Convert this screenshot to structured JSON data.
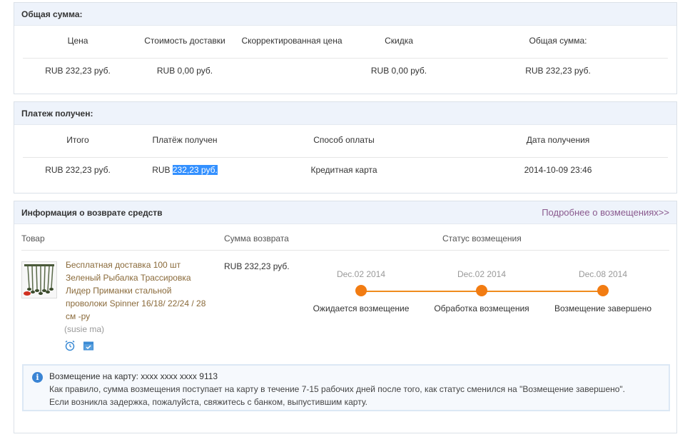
{
  "summary": {
    "title": "Общая сумма:",
    "headers": [
      "Цена",
      "Стоимость доставки",
      "Скорректированная цена",
      "Скидка",
      "Общая сумма:"
    ],
    "values": [
      "RUB 232,23 руб.",
      "RUB 0,00 руб.",
      "",
      "RUB 0,00 руб.",
      "RUB 232,23 руб."
    ]
  },
  "payment": {
    "title": "Платеж получен:",
    "headers": [
      "Итого",
      "Платёж получен",
      "Способ оплаты",
      "Дата получения"
    ],
    "total": "RUB 232,23 руб.",
    "received_prefix": "RUB",
    "received_highlight": "232,23 руб.",
    "method": "Кредитная карта",
    "date": "2014-10-09 23:46"
  },
  "refund": {
    "title": "Информация о возврате средств",
    "more_link": "Подробнее о возмещениях>>",
    "col_product": "Товар",
    "col_amount": "Сумма возврата",
    "col_status": "Статус возмещения",
    "product_title": "Бесплатная доставка 100 шт Зеленый Рыбалка Трассировка Лидер Приманки стальной проволоки Spinner 16/18/ 22/24 / 28 см -ру",
    "seller": "(susie ma)",
    "amount": "RUB 232,23 руб.",
    "steps": [
      {
        "date": "Dec.02 2014",
        "label": "Ожидается возмещение"
      },
      {
        "date": "Dec.02 2014",
        "label": "Обработка возмещения"
      },
      {
        "date": "Dec.08 2014",
        "label": "Возмещение завершено"
      }
    ],
    "accent_color": "#f27c12",
    "info": {
      "line1_label": "Возмещение на карту:",
      "line1_value": "xxxx xxxx xxxx 9113",
      "line2": "Как правило, сумма возмещения поступает на карту в течение 7-15 рабочих дней после того, как статус сменился на \"Возмещение завершено\".",
      "line3": "Если возникла задержка, пожалуйста, свяжитесь с банком, выпустившим карту."
    }
  }
}
